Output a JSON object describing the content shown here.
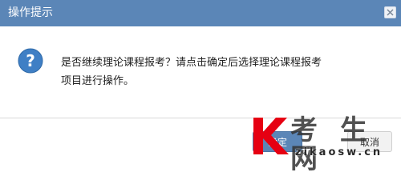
{
  "dialog": {
    "title": "操作提示",
    "message_line1": "是否继续理论课程报考？请点击确定后选择理论课程报考",
    "message_line2": "项目进行操作。",
    "icon": "question-icon",
    "close_icon": "close-icon"
  },
  "buttons": {
    "ok_label": "确定",
    "cancel_label": "取消"
  },
  "watermark": {
    "logo_letter": "K",
    "site_name": "考 生 网",
    "domain": "zikaosw.cn"
  },
  "colors": {
    "titlebar": "#5b86b7",
    "icon": "#3f7fc5",
    "logo_red": "#e60012"
  }
}
